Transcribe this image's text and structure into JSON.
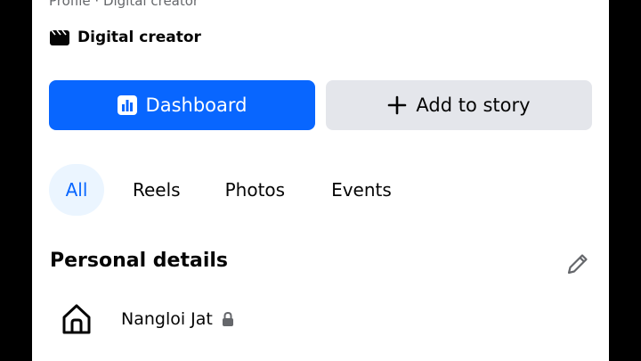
{
  "profile": {
    "subtitle": "Profile · Digital creator",
    "category": "Digital creator"
  },
  "actions": {
    "dashboard_label": "Dashboard",
    "add_story_label": "Add to story"
  },
  "tabs": [
    {
      "label": "All",
      "active": true
    },
    {
      "label": "Reels",
      "active": false
    },
    {
      "label": "Photos",
      "active": false
    },
    {
      "label": "Events",
      "active": false
    }
  ],
  "personal_details": {
    "title": "Personal details",
    "items": [
      {
        "icon": "home-icon",
        "label": "Nangloi Jat",
        "private": true
      }
    ]
  },
  "colors": {
    "accent": "#0866ff",
    "secondary_button": "#e4e6eb",
    "active_tab_bg": "#ebf5ff",
    "muted_text": "#65676b"
  }
}
